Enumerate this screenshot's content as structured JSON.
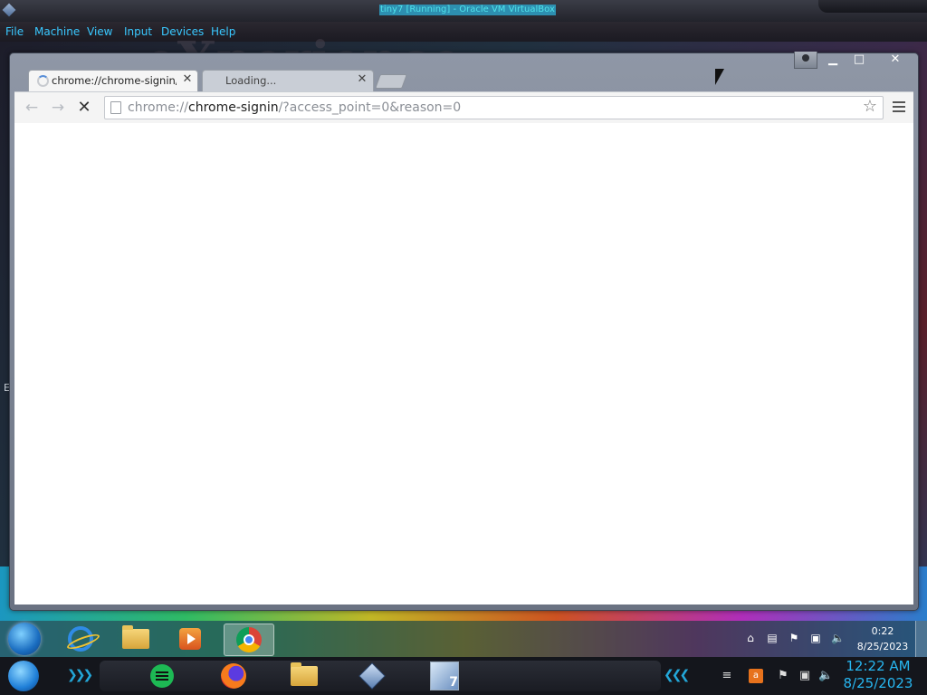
{
  "host": {
    "title": "tiny7 [Running] - Oracle VM VirtualBox",
    "menu": [
      "File",
      "Machine",
      "View",
      "Input",
      "Devices",
      "Help"
    ]
  },
  "desktop": {
    "watermark": "eXperience",
    "edge_letter": "E"
  },
  "browser": {
    "tabs": [
      {
        "title": "chrome://chrome-signin/",
        "state": "loading"
      },
      {
        "title": "Loading...",
        "state": "inactive"
      }
    ],
    "omnibox": {
      "scheme": "chrome://",
      "host": "chrome-signin",
      "path": "/?access_point=0&reason=0"
    },
    "icons": {
      "back": "back-arrow-icon",
      "forward": "forward-arrow-icon",
      "stop": "stop-x-icon",
      "page": "page-icon",
      "star": "star-icon",
      "menu": "hamburger-menu-icon"
    }
  },
  "guest_taskbar": {
    "pinned": [
      "internet-explorer-icon",
      "windows-explorer-icon",
      "media-player-icon",
      "chrome-icon"
    ],
    "active": "chrome-icon",
    "clock_time": "0:22",
    "clock_date": "8/25/2023"
  },
  "host_taskbar": {
    "pinned": [
      "spotify-icon",
      "firefox-icon",
      "file-explorer-icon",
      "virtualbox-icon",
      "windows7-vm-icon"
    ],
    "clock_time": "12:22 AM",
    "clock_date": "8/25/2023"
  }
}
